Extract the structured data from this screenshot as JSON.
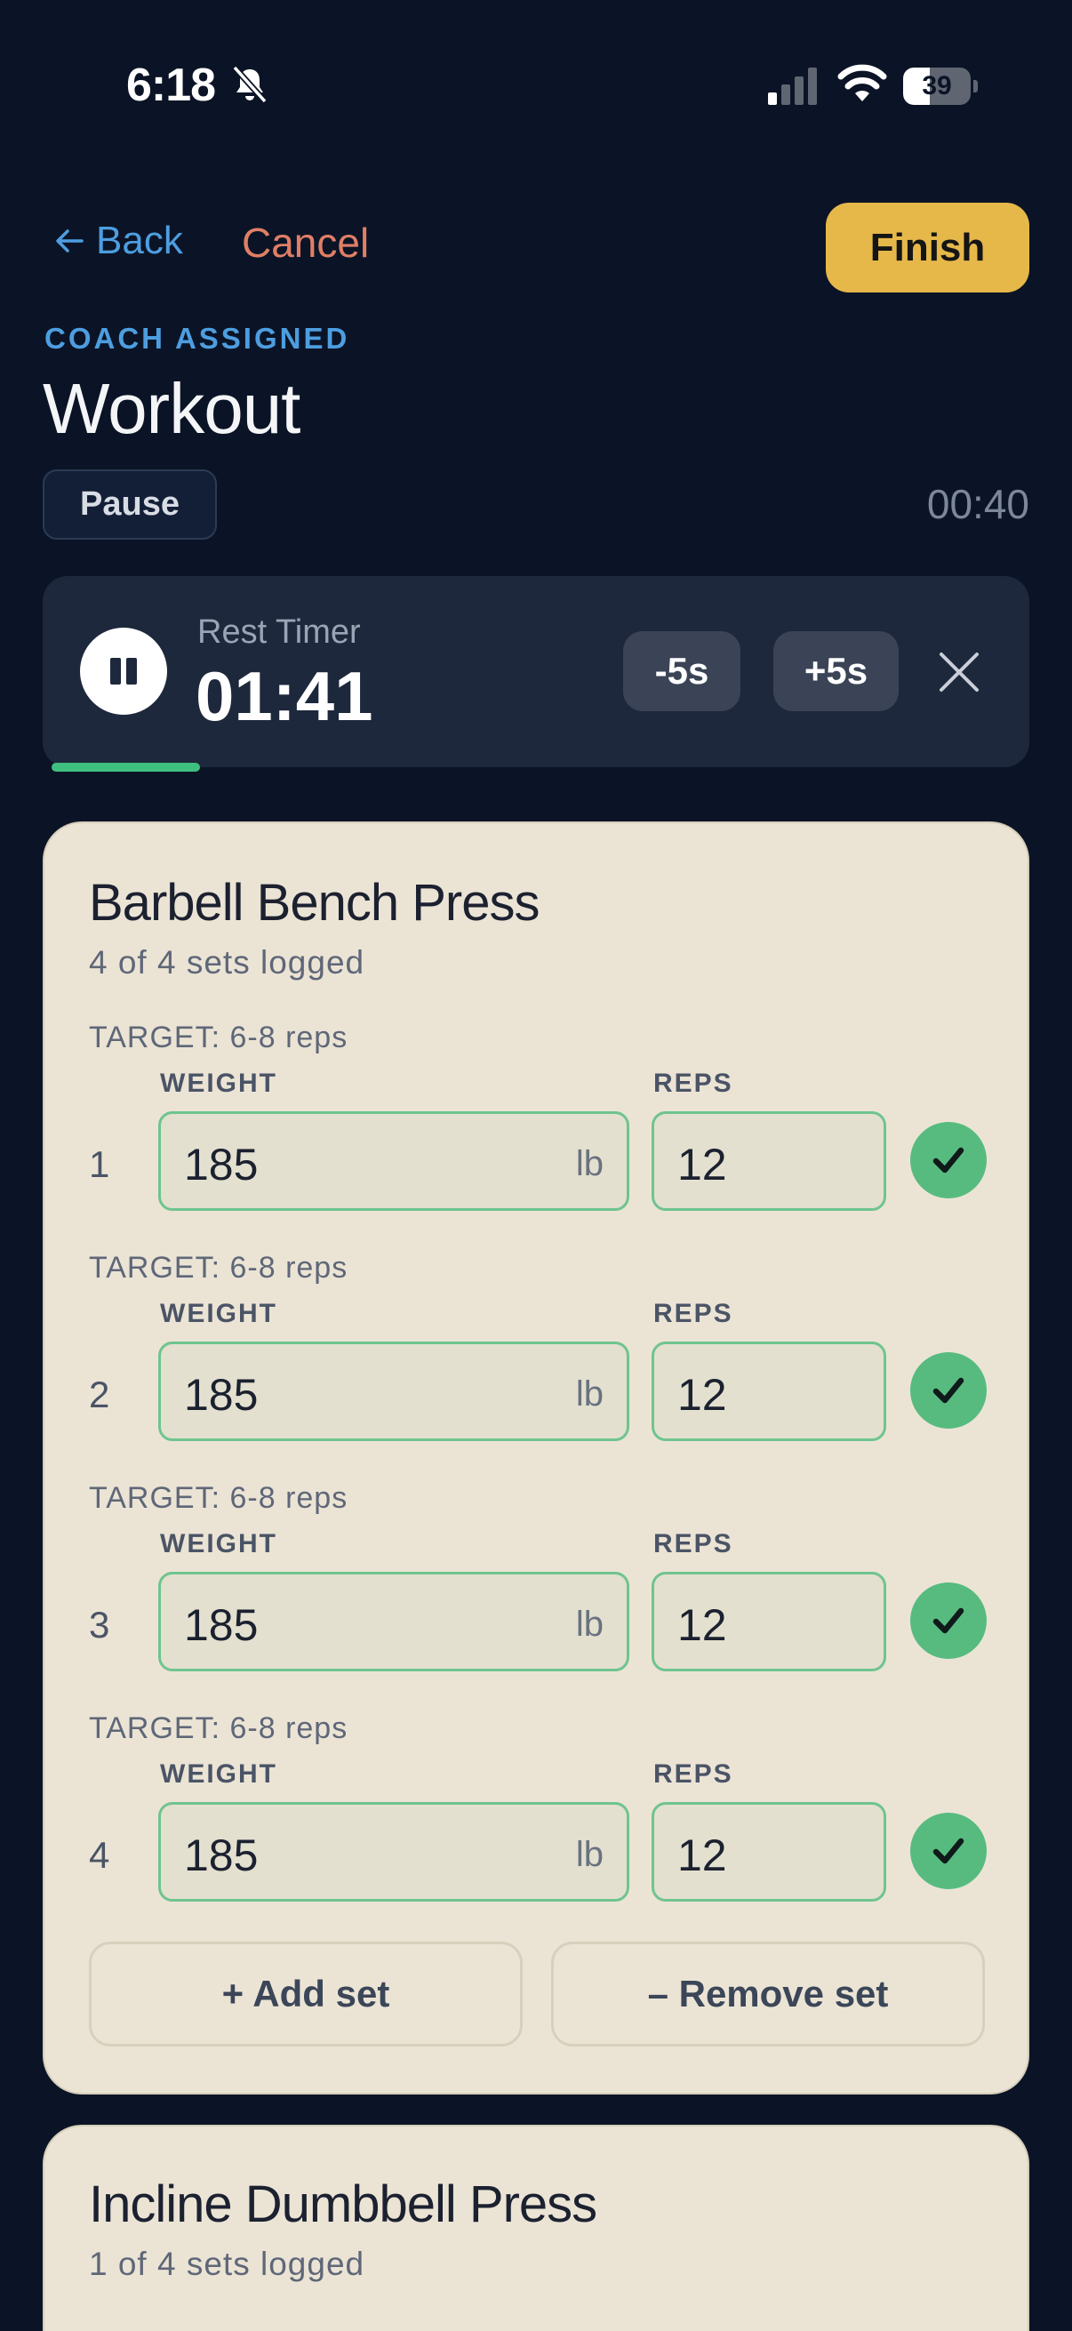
{
  "status_bar": {
    "time": "6:18",
    "battery": "39",
    "battery_level": 0.39
  },
  "header": {
    "back_label": "Back",
    "cancel_label": "Cancel",
    "finish_label": "Finish",
    "eyebrow": "COACH ASSIGNED",
    "title": "Workout",
    "pause_label": "Pause",
    "elapsed": "00:40"
  },
  "rest_timer": {
    "label": "Rest Timer",
    "time": "01:41",
    "minus_label": "-5s",
    "plus_label": "+5s",
    "progress": 0.15
  },
  "exercises": [
    {
      "name": "Barbell Bench Press",
      "summary": "4 of 4 sets logged",
      "weight_header": "WEIGHT",
      "reps_header": "REPS",
      "sets": [
        {
          "target": "TARGET: 6-8 reps",
          "number": "1",
          "weight": "185",
          "unit": "lb",
          "reps": "12"
        },
        {
          "target": "TARGET: 6-8 reps",
          "number": "2",
          "weight": "185",
          "unit": "lb",
          "reps": "12"
        },
        {
          "target": "TARGET: 6-8 reps",
          "number": "3",
          "weight": "185",
          "unit": "lb",
          "reps": "12"
        },
        {
          "target": "TARGET: 6-8 reps",
          "number": "4",
          "weight": "185",
          "unit": "lb",
          "reps": "12"
        }
      ],
      "add_set_label": "+ Add set",
      "remove_set_label": "– Remove set"
    },
    {
      "name": "Incline Dumbbell Press",
      "summary": "1 of 4 sets logged"
    }
  ],
  "colors": {
    "background": "#0b1426",
    "accent_blue": "#4d9ee0",
    "cancel": "#e07f66",
    "finish": "#e6b84a",
    "success": "#57bb7f",
    "card": "#ebe4d5"
  }
}
